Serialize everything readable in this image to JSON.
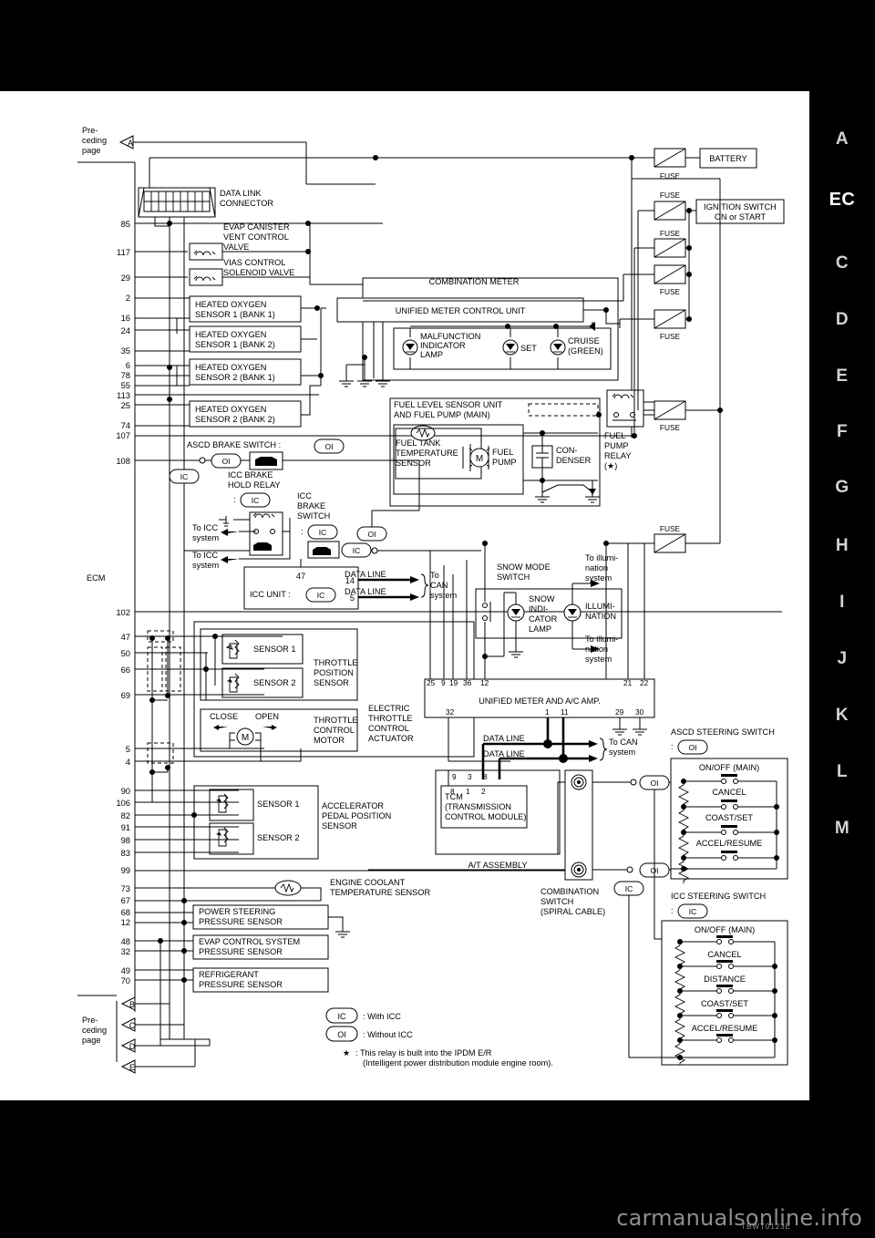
{
  "document": {
    "section_tab": "EC",
    "watermark": "carmanualsonline.info",
    "diagram_code": "TBWT0123E",
    "right_tabs": [
      "A",
      "EC",
      "C",
      "D",
      "E",
      "F",
      "G",
      "H",
      "I",
      "J",
      "K",
      "L",
      "M"
    ]
  },
  "labels": {
    "preceding_page_top": "Pre-\nceding\npage",
    "preceding_page_bottom": "Pre-\nceding\npage",
    "ecm": "ECM",
    "data_link_connector": "DATA LINK\nCONNECTOR",
    "evap_canister_vent_control_valve": "EVAP CANISTER\nVENT CONTROL\nVALVE",
    "vias_control_solenoid_valve": "VIAS CONTROL\nSOLENOID VALVE",
    "ho2s1_bank1": "HEATED OXYGEN\nSENSOR 1 (BANK 1)",
    "ho2s1_bank2": "HEATED OXYGEN\nSENSOR 1 (BANK 2)",
    "ho2s2_bank1": "HEATED OXYGEN\nSENSOR 2 (BANK 1)",
    "ho2s2_bank2": "HEATED OXYGEN\nSENSOR 2 (BANK 2)",
    "ascd_brake_switch": "ASCD BRAKE SWITCH :",
    "icc_brake_hold_relay": "ICC BRAKE\nHOLD RELAY",
    "icc_brake_switch": "ICC\nBRAKE\nSWITCH",
    "to_icc_system": "To ICC\nsystem",
    "icc_unit": "ICC UNIT :",
    "data_line": "DATA LINE",
    "to_can_system": "To\nCAN\nsystem",
    "combination_meter": "COMBINATION METER",
    "unified_meter_control_unit": "UNIFIED METER CONTROL UNIT",
    "malfunction_indicator_lamp": "MALFUNCTION\nINDICATOR\nLAMP",
    "set_lamp": "SET",
    "cruise_lamp": "CRUISE\n(GREEN)",
    "fuel_level_sensor_unit": "FUEL LEVEL SENSOR UNIT\nAND FUEL PUMP (MAIN)",
    "fuel_tank_temperature_sensor": "FUEL TANK\nTEMPERATURE\nSENSOR",
    "fuel_pump": "FUEL\nPUMP",
    "condenser": "CON-\nDENSER",
    "fuel_pump_relay": "FUEL\nPUMP\nRELAY\n(★)",
    "battery": "BATTERY",
    "ignition_switch": "IGNITION SWITCH\nON or START",
    "fuse": "FUSE",
    "snow_mode_switch": "SNOW MODE\nSWITCH",
    "snow_indicator_lamp": "SNOW\nINDI-\nCATOR\nLAMP",
    "illumination": "ILLUMI-\nNATION",
    "to_illumination_system": "To illumi-\nnation\nsystem",
    "unified_meter_ac_amp": "UNIFIED METER AND A/C AMP.",
    "throttle_position_sensor": "THROTTLE\nPOSITION\nSENSOR",
    "electric_throttle_control_actuator": "ELECTRIC\nTHROTTLE\nCONTROL\nACTUATOR",
    "throttle_control_motor": "THROTTLE\nCONTROL\nMOTOR",
    "close": "CLOSE",
    "open": "OPEN",
    "sensor_1": "SENSOR 1",
    "sensor_2": "SENSOR 2",
    "accelerator_pedal_position_sensor": "ACCELERATOR\nPEDAL POSITION\nSENSOR",
    "tcm": "TCM\n(TRANSMISSION\n CONTROL MODULE)",
    "at_assembly": "A/T ASSEMBLY",
    "engine_coolant_temperature_sensor": "ENGINE COOLANT\nTEMPERATURE SENSOR",
    "power_steering_pressure_sensor": "POWER STEERING\nPRESSURE SENSOR",
    "evap_control_system_pressure_sensor": "EVAP CONTROL SYSTEM\nPRESSURE SENSOR",
    "refrigerant_pressure_sensor": "REFRIGERANT\nPRESSURE SENSOR",
    "combination_switch_spiral_cable": "COMBINATION\nSWITCH\n(SPIRAL CABLE)",
    "ascd_steering_switch": "ASCD STEERING SWITCH",
    "icc_steering_switch": "ICC STEERING SWITCH",
    "with_icc": ": With ICC",
    "without_icc": ": Without ICC",
    "relay_note": ": This relay is built into the IPDM E/R\n(Intelligent power distribution module engine room)."
  },
  "badges": {
    "ic": "IC",
    "oi": "OI",
    "star": "★"
  },
  "ecm_pins_upper": [
    "85",
    "117",
    "29",
    "2",
    "16",
    "24",
    "35",
    "6",
    "78",
    "55",
    "113",
    "25",
    "74",
    "107",
    "108"
  ],
  "ecm_pins_lower": [
    "102",
    "47",
    "50",
    "66",
    "69",
    "5",
    "4",
    "90",
    "106",
    "82",
    "91",
    "98",
    "83",
    "99",
    "73",
    "67",
    "68",
    "12",
    "48",
    "32",
    "49",
    "70"
  ],
  "unified_meter_amp_pins": {
    "top": [
      "25",
      "9",
      "19",
      "36",
      "12",
      "21",
      "22"
    ],
    "bottom": [
      "32",
      "1",
      "11",
      "29",
      "30"
    ]
  },
  "tcm_pins": {
    "top": [
      "9",
      "3",
      "8"
    ],
    "bottom": [
      "8",
      "1",
      "2"
    ]
  },
  "icc_unit_pins": {
    "top": "47",
    "right": [
      "14",
      "5"
    ]
  },
  "steering_switch_buttons": {
    "ascd": [
      "ON/OFF (MAIN)",
      "CANCEL",
      "COAST/SET",
      "ACCEL/RESUME"
    ],
    "icc": [
      "ON/OFF (MAIN)",
      "CANCEL",
      "DISTANCE",
      "COAST/SET",
      "ACCEL/RESUME"
    ]
  },
  "connectors": {
    "top": "A",
    "bottom": [
      "B",
      "C",
      "D",
      "E"
    ]
  }
}
